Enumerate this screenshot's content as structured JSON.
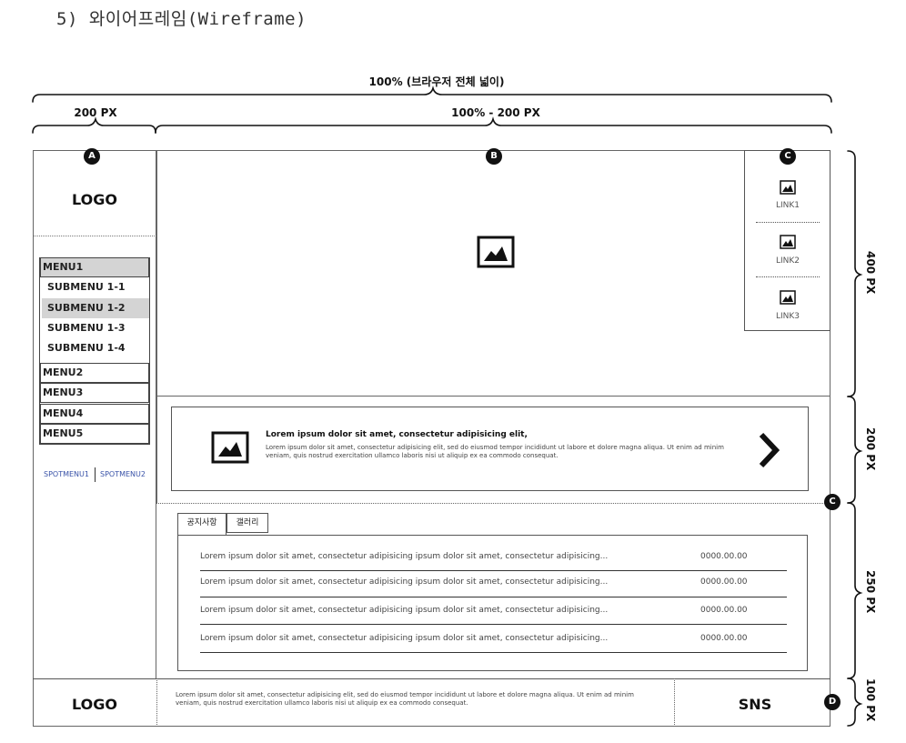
{
  "page_title": "5) 와이어프레임(Wireframe)",
  "dimensions": {
    "full_width": "100% (브라우저 전체 넓이)",
    "sidebar_width": "200 PX",
    "content_width": "100% - 200 PX",
    "h_400": "400 PX",
    "h_200": "200 PX",
    "h_250": "250 PX",
    "h_100": "100 PX"
  },
  "badges": {
    "a": "A",
    "b": "B",
    "c": "C",
    "d": "D"
  },
  "sidebar": {
    "logo": "LOGO",
    "menu": [
      {
        "label": "MENU1",
        "selected": true
      },
      {
        "label": "SUBMENU 1-1",
        "selected": false
      },
      {
        "label": "SUBMENU 1-2",
        "selected": true
      },
      {
        "label": "SUBMENU 1-3",
        "selected": false
      },
      {
        "label": "SUBMENU 1-4",
        "selected": false
      },
      {
        "label": "MENU2",
        "selected": false
      },
      {
        "label": "MENU3",
        "selected": false
      },
      {
        "label": "MENU4",
        "selected": false
      },
      {
        "label": "MENU5",
        "selected": false
      }
    ],
    "spot_menus": [
      "SPOTMENU1",
      "SPOTMENU2"
    ]
  },
  "quick_links": [
    "LINK1",
    "LINK2",
    "LINK3"
  ],
  "banner": {
    "title": "Lorem ipsum dolor sit amet, consectetur adipisicing elit,",
    "text": "Lorem ipsum dolor sit amet, consectetur adipisicing elit, sed do eiusmod tempor incididunt ut labore et dolore magna aliqua. Ut enim ad minim veniam, quis nostrud exercitation ullamco laboris nisi ut aliquip ex ea commodo consequat."
  },
  "tabs": [
    "공지사항",
    "갤러리"
  ],
  "notices": [
    {
      "title": "Lorem ipsum dolor sit amet, consectetur adipisicing ipsum dolor sit amet, consectetur adipisicing...",
      "date": "0000.00.00"
    },
    {
      "title": "Lorem ipsum dolor sit amet, consectetur adipisicing ipsum dolor sit amet, consectetur adipisicing...",
      "date": "0000.00.00"
    },
    {
      "title": "Lorem ipsum dolor sit amet, consectetur adipisicing ipsum dolor sit amet, consectetur adipisicing...",
      "date": "0000.00.00"
    },
    {
      "title": "Lorem ipsum dolor sit amet, consectetur adipisicing ipsum dolor sit amet, consectetur adipisicing...",
      "date": "0000.00.00"
    }
  ],
  "footer": {
    "logo": "LOGO",
    "text": "Lorem ipsum dolor sit amet, consectetur adipisicing elit, sed do eiusmod tempor incididunt ut labore et dolore magna aliqua. Ut enim ad minim veniam, quis nostrud exercitation ullamco laboris nisi ut aliquip ex ea commodo consequat.",
    "sns": "SNS"
  }
}
